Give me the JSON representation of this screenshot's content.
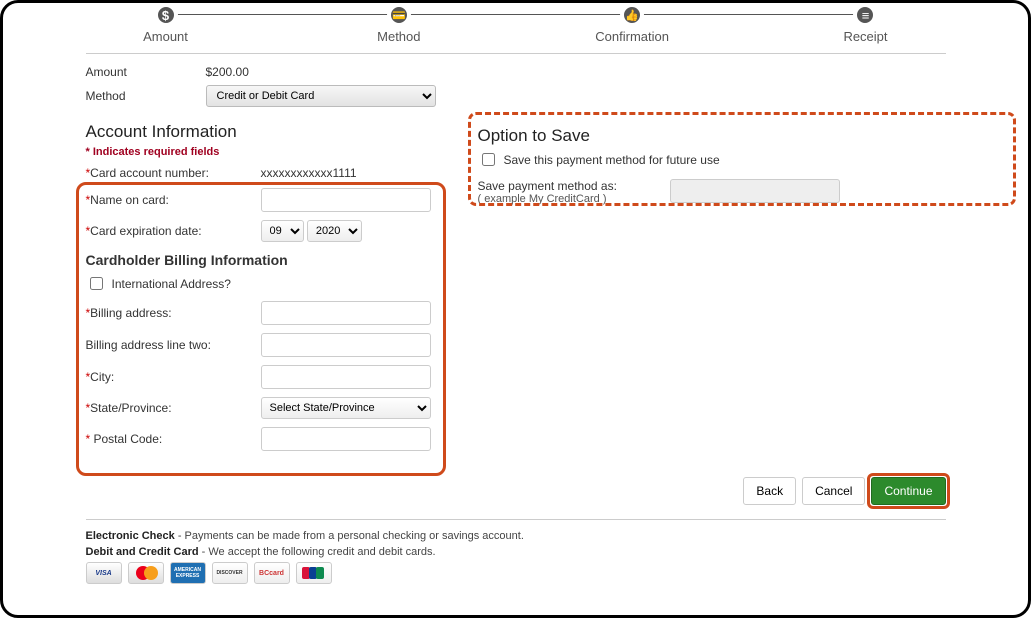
{
  "tracker": {
    "steps": [
      {
        "label": "Amount",
        "icon": "$"
      },
      {
        "label": "Method",
        "icon": "💳"
      },
      {
        "label": "Confirmation",
        "icon": "👍"
      },
      {
        "label": "Receipt",
        "icon": "≡"
      }
    ]
  },
  "summary": {
    "amount_label": "Amount",
    "amount_value": "$200.00",
    "method_label": "Method",
    "method_value": "Credit or Debit Card"
  },
  "account": {
    "heading": "Account Information",
    "required_note": "* Indicates required fields",
    "card_number_label": "Card account number:",
    "card_number_value": "xxxxxxxxxxxx1111",
    "name_label": "Name on card:",
    "name_value": "",
    "exp_label": "Card expiration date:",
    "exp_month": "09",
    "exp_year": "2020"
  },
  "billing": {
    "heading": "Cardholder Billing Information",
    "international_label": "International Address?",
    "addr1_label": "Billing address:",
    "addr2_label": "Billing address line two:",
    "city_label": "City:",
    "state_label": "State/Province:",
    "state_placeholder": "Select State/Province",
    "postal_label": " Postal Code:"
  },
  "save": {
    "heading": "Option to Save",
    "checkbox_label": "Save this payment method for future use",
    "name_label": "Save payment method as:",
    "example": "( example My CreditCard )",
    "name_value": ""
  },
  "buttons": {
    "back": "Back",
    "cancel": "Cancel",
    "continue": "Continue"
  },
  "footer": {
    "echeck_bold": "Electronic Check",
    "echeck_text": " - Payments can be made from a personal checking or savings  account.",
    "card_bold": "Debit and Credit Card",
    "card_text": " - We accept the following credit and debit cards.",
    "cards": {
      "visa": "VISA",
      "amex": "AMERICAN EXPRESS",
      "discover": "DISCOVER",
      "bccard": "BCcard"
    }
  }
}
